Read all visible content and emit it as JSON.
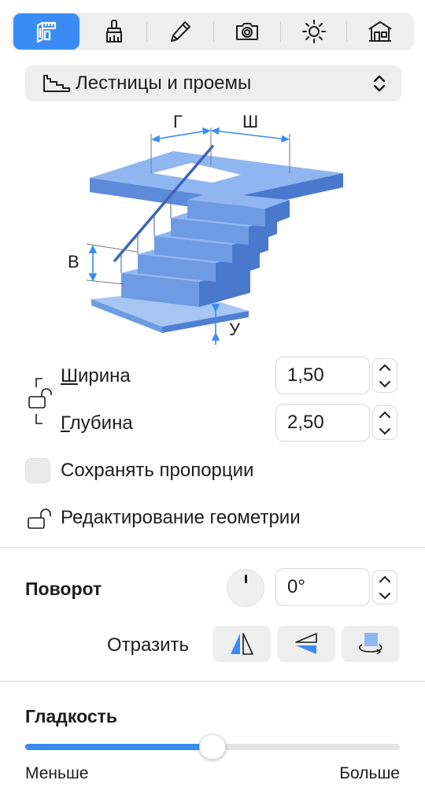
{
  "toolbar": {
    "tools": [
      {
        "icon": "dimensions-icon",
        "active": true
      },
      {
        "icon": "brush-icon",
        "active": false
      },
      {
        "icon": "pencil-icon",
        "active": false
      },
      {
        "icon": "camera-icon",
        "active": false
      },
      {
        "icon": "sun-icon",
        "active": false
      },
      {
        "icon": "house-icon",
        "active": false
      }
    ],
    "accent": "#3a8cf4"
  },
  "category": {
    "icon": "stairs-icon",
    "label": "Лестницы и проемы"
  },
  "illustration": {
    "labels": {
      "g": "Г",
      "sh": "Ш",
      "v": "В",
      "u": "У"
    },
    "colors": {
      "stair_light": "#8fb6f0",
      "stair_mid": "#6f9be3",
      "stair_dark": "#4a78cc",
      "arrow": "#3a8cf4"
    }
  },
  "dimensions": {
    "width": {
      "prefix": "Ш",
      "label": "ирина",
      "value": "1,50"
    },
    "depth": {
      "prefix": "Г",
      "label": "лубина",
      "value": "2,50"
    }
  },
  "keep_proportions": {
    "label": "Сохранять пропорции",
    "checked": false
  },
  "edit_geometry": {
    "label": "Редактирование геометрии"
  },
  "rotation": {
    "title": "Поворот",
    "value": "0°"
  },
  "reflect": {
    "label": "Отразить",
    "buttons": [
      "mirror-horizontal-icon",
      "mirror-vertical-icon",
      "rotate-3d-icon"
    ]
  },
  "smoothness": {
    "title": "Гладкость",
    "min_label": "Меньше",
    "max_label": "Больше",
    "value": 0.5
  }
}
